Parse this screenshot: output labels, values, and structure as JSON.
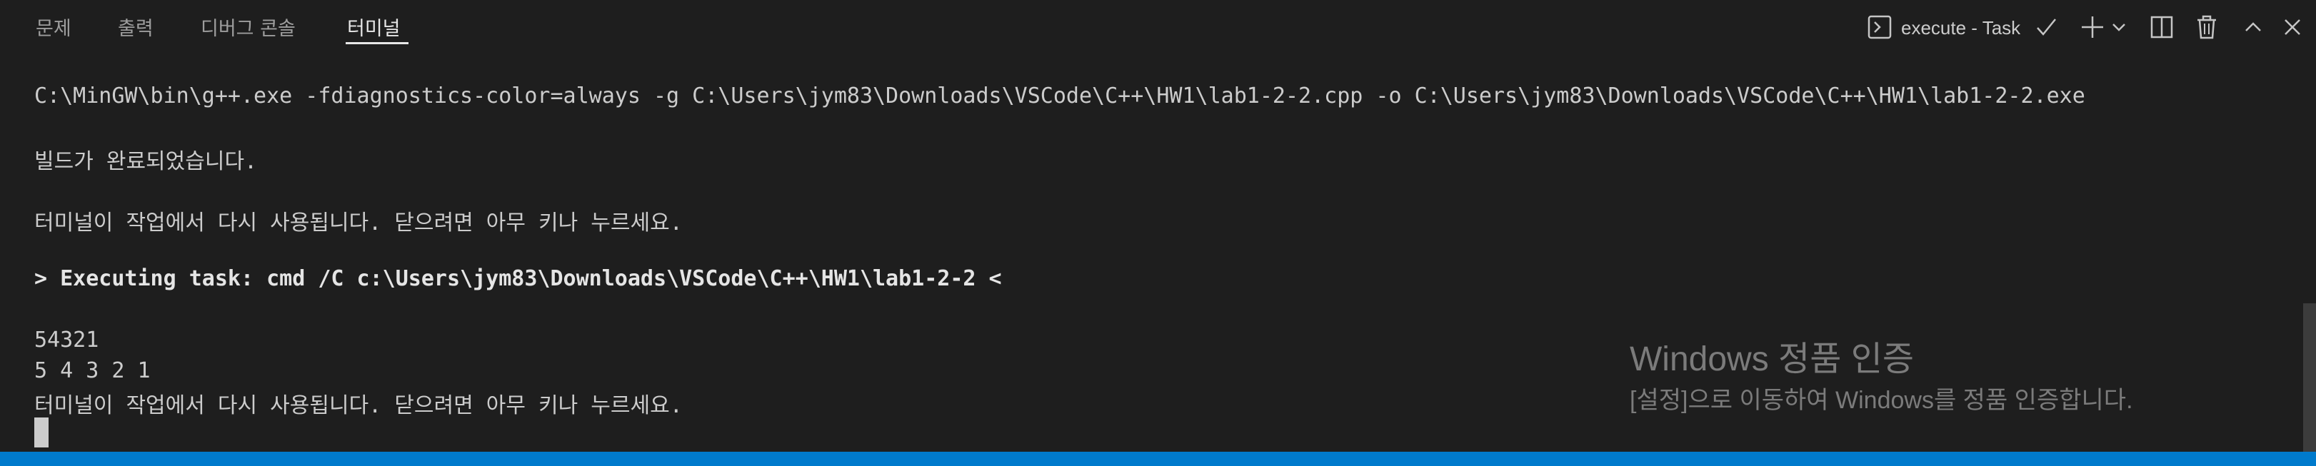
{
  "panel": {
    "tabs": [
      {
        "label": "문제",
        "active": false
      },
      {
        "label": "출력",
        "active": false
      },
      {
        "label": "디버그 콘솔",
        "active": false
      },
      {
        "label": "터미널",
        "active": true
      }
    ],
    "toolbar": {
      "task_name": "execute - Task",
      "icons": [
        "terminal-icon",
        "check-icon",
        "plus-icon",
        "chevron-down-icon",
        "split-icon",
        "trash-icon",
        "chevron-up-icon",
        "close-icon"
      ]
    }
  },
  "terminal": {
    "lines": [
      "C:\\MinGW\\bin\\g++.exe -fdiagnostics-color=always -g C:\\Users\\jym83\\Downloads\\VSCode\\C++\\HW1\\lab1-2-2.cpp -o C:\\Users\\jym83\\Downloads\\VSCode\\C++\\HW1\\lab1-2-2.exe",
      "빌드가 완료되었습니다.",
      "터미널이 작업에서 다시 사용됩니다. 닫으려면 아무 키나 누르세요.",
      "> Executing task: cmd /C c:\\Users\\jym83\\Downloads\\VSCode\\C++\\HW1\\lab1-2-2 <",
      "54321",
      "5 4 3 2 1",
      "터미널이 작업에서 다시 사용됩니다. 닫으려면 아무 키나 누르세요."
    ]
  },
  "watermark": {
    "title": "Windows 정품 인증",
    "subtitle": "[설정]으로 이동하여 Windows를 정품 인증합니다."
  },
  "colors": {
    "background": "#1e1e1e",
    "text": "#cccccc",
    "status_bar": "#007acc"
  }
}
